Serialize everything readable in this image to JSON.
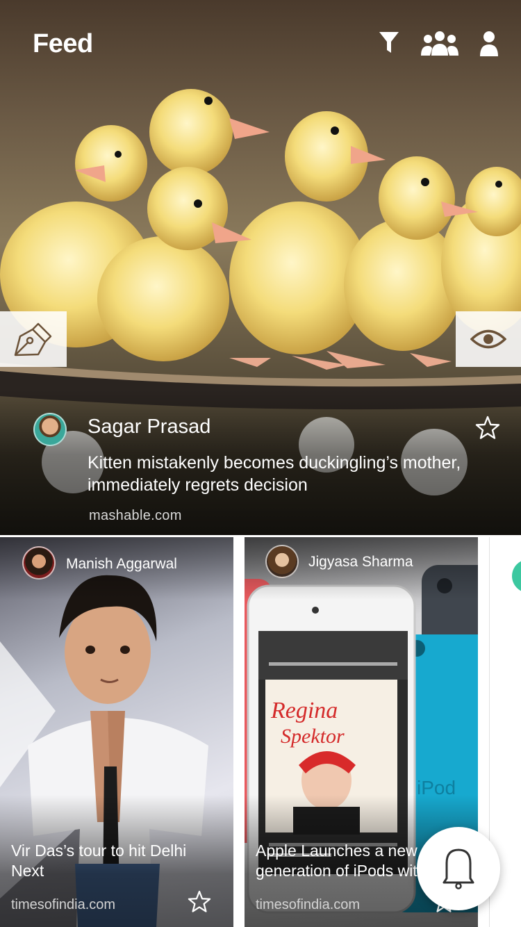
{
  "header": {
    "title": "Feed",
    "icons": [
      "filter-icon",
      "group-icon",
      "profile-icon"
    ]
  },
  "hero": {
    "author": "Sagar Prasad",
    "headline": "Kitten mistakenly becomes duckingling’s mother, immediately regrets decision",
    "source": "mashable.com",
    "left_action_icon": "pen-icon",
    "right_action_icon": "eye-icon",
    "star_icon": "star-outline-icon",
    "image": "ducklings on skateboard"
  },
  "cards": [
    {
      "author": "Manish Aggarwal",
      "title": "Vir Das’s tour to hit Delhi Next",
      "source": "timesofindia.com",
      "image": "man with folded hands"
    },
    {
      "author": "Jigyasa Sharma",
      "title": "Apple Launches a new generation of iPods with.....",
      "source": "timesofindia.com",
      "image": "iPod devices"
    }
  ],
  "fab": {
    "icon": "bell-icon"
  },
  "colors": {
    "accent": "#3cc8a0",
    "icon_tint": "#6b5238"
  }
}
